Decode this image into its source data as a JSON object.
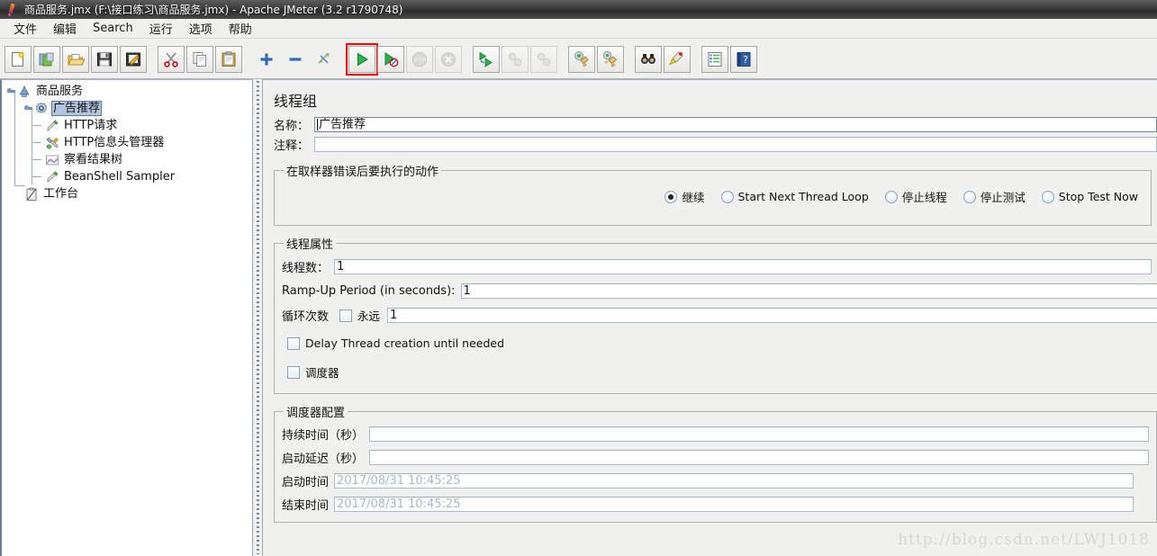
{
  "window": {
    "title": "商品服务.jmx (F:\\接口练习\\商品服务.jmx) - Apache JMeter (3.2 r1790748)",
    "app_icon": "jmeter-feather-icon"
  },
  "menubar": {
    "items": [
      {
        "label": "文件",
        "name": "menu-file"
      },
      {
        "label": "编辑",
        "name": "menu-edit"
      },
      {
        "label": "Search",
        "name": "menu-search"
      },
      {
        "label": "运行",
        "name": "menu-run"
      },
      {
        "label": "选项",
        "name": "menu-options"
      },
      {
        "label": "帮助",
        "name": "menu-help"
      }
    ]
  },
  "toolbar": {
    "highlight_color": "#ff0000",
    "buttons": [
      {
        "name": "new-button",
        "icon": "new-document-icon",
        "enabled": true,
        "highlighted": false
      },
      {
        "name": "templates-button",
        "icon": "templates-icon",
        "enabled": true,
        "highlighted": false
      },
      {
        "name": "open-button",
        "icon": "open-folder-icon",
        "enabled": true,
        "highlighted": false
      },
      {
        "name": "save-button",
        "icon": "save-floppy-icon",
        "enabled": true,
        "highlighted": false
      },
      {
        "name": "save-as-button",
        "icon": "save-as-icon",
        "enabled": true,
        "highlighted": false
      },
      {
        "name": "cut-button",
        "icon": "scissors-icon",
        "enabled": true,
        "highlighted": false
      },
      {
        "name": "copy-button",
        "icon": "copy-icon",
        "enabled": true,
        "highlighted": false
      },
      {
        "name": "paste-button",
        "icon": "clipboard-paste-icon",
        "enabled": true,
        "highlighted": false
      },
      {
        "name": "expand-all-button",
        "icon": "plus-icon",
        "enabled": true,
        "highlighted": false
      },
      {
        "name": "collapse-all-button",
        "icon": "minus-icon",
        "enabled": true,
        "highlighted": false
      },
      {
        "name": "toggle-button",
        "icon": "toggle-arrows-icon",
        "enabled": true,
        "highlighted": false
      },
      {
        "name": "start-button",
        "icon": "play-green-icon",
        "enabled": true,
        "highlighted": true
      },
      {
        "name": "start-no-pauses-button",
        "icon": "play-no-pause-icon",
        "enabled": true,
        "highlighted": false
      },
      {
        "name": "stop-button",
        "icon": "stop-sign-icon",
        "enabled": false,
        "highlighted": false
      },
      {
        "name": "shutdown-button",
        "icon": "shutdown-x-icon",
        "enabled": false,
        "highlighted": false
      },
      {
        "name": "remote-start-all-button",
        "icon": "remote-start-icon",
        "enabled": true,
        "highlighted": false
      },
      {
        "name": "remote-stop-all-button",
        "icon": "remote-stop-icon",
        "enabled": false,
        "highlighted": false
      },
      {
        "name": "remote-shutdown-all-button",
        "icon": "remote-shutdown-icon",
        "enabled": false,
        "highlighted": false
      },
      {
        "name": "clear-button",
        "icon": "clear-broom-icon",
        "enabled": true,
        "highlighted": false
      },
      {
        "name": "clear-all-button",
        "icon": "clear-all-broom-icon",
        "enabled": true,
        "highlighted": false
      },
      {
        "name": "search-button",
        "icon": "binoculars-icon",
        "enabled": true,
        "highlighted": false
      },
      {
        "name": "search-reset-button",
        "icon": "broom-reset-icon",
        "enabled": true,
        "highlighted": false
      },
      {
        "name": "function-helper-button",
        "icon": "function-list-icon",
        "enabled": true,
        "highlighted": false
      },
      {
        "name": "help-button",
        "icon": "help-question-icon",
        "enabled": true,
        "highlighted": false
      }
    ]
  },
  "tree": {
    "nodes": [
      {
        "label": "商品服务",
        "icon": "test-plan-icon",
        "depth": 0,
        "selected": false,
        "expanded": true
      },
      {
        "label": "广告推荐",
        "icon": "thread-group-gear-icon",
        "depth": 1,
        "selected": true,
        "expanded": true
      },
      {
        "label": "HTTP请求",
        "icon": "http-sampler-icon",
        "depth": 2,
        "selected": false,
        "expanded": false
      },
      {
        "label": "HTTP信息头管理器",
        "icon": "header-manager-icon",
        "depth": 2,
        "selected": false,
        "expanded": false
      },
      {
        "label": "察看结果树",
        "icon": "view-results-tree-icon",
        "depth": 2,
        "selected": false,
        "expanded": false
      },
      {
        "label": "BeanShell Sampler",
        "icon": "beanshell-sampler-icon",
        "depth": 2,
        "selected": false,
        "expanded": false
      },
      {
        "label": "工作台",
        "icon": "workbench-icon",
        "depth": 0,
        "selected": false,
        "expanded": false
      }
    ]
  },
  "main": {
    "panel_title": "线程组",
    "name_label": "名称：",
    "name_value": "广告推荐",
    "comment_label": "注释：",
    "comment_value": "",
    "on_error": {
      "legend": "在取样器错误后要执行的动作",
      "options": [
        {
          "label": "继续",
          "selected": true
        },
        {
          "label": "Start Next Thread Loop",
          "selected": false
        },
        {
          "label": "停止线程",
          "selected": false
        },
        {
          "label": "停止测试",
          "selected": false
        },
        {
          "label": "Stop Test Now",
          "selected": false
        }
      ]
    },
    "thread_properties": {
      "legend": "线程属性",
      "threads_label": "线程数：",
      "threads_value": "1",
      "rampup_label": "Ramp-Up Period (in seconds):",
      "rampup_value": "1",
      "loop_label": "循环次数",
      "forever_label": "永远",
      "forever_checked": false,
      "loop_value": "1",
      "delay_thread_label": "Delay Thread creation until needed",
      "delay_thread_checked": false,
      "scheduler_label": "调度器",
      "scheduler_checked": false
    },
    "scheduler_config": {
      "legend": "调度器配置",
      "duration_label": "持续时间（秒）",
      "duration_value": "",
      "startup_delay_label": "启动延迟（秒）",
      "startup_delay_value": "",
      "start_time_label": "启动时间",
      "start_time_value": "2017/08/31 10:45:25",
      "end_time_label": "结束时间",
      "end_time_value": "2017/08/31 10:45:25"
    }
  },
  "watermark": {
    "text": "http://blog.csdn.net/LWJ1018"
  }
}
